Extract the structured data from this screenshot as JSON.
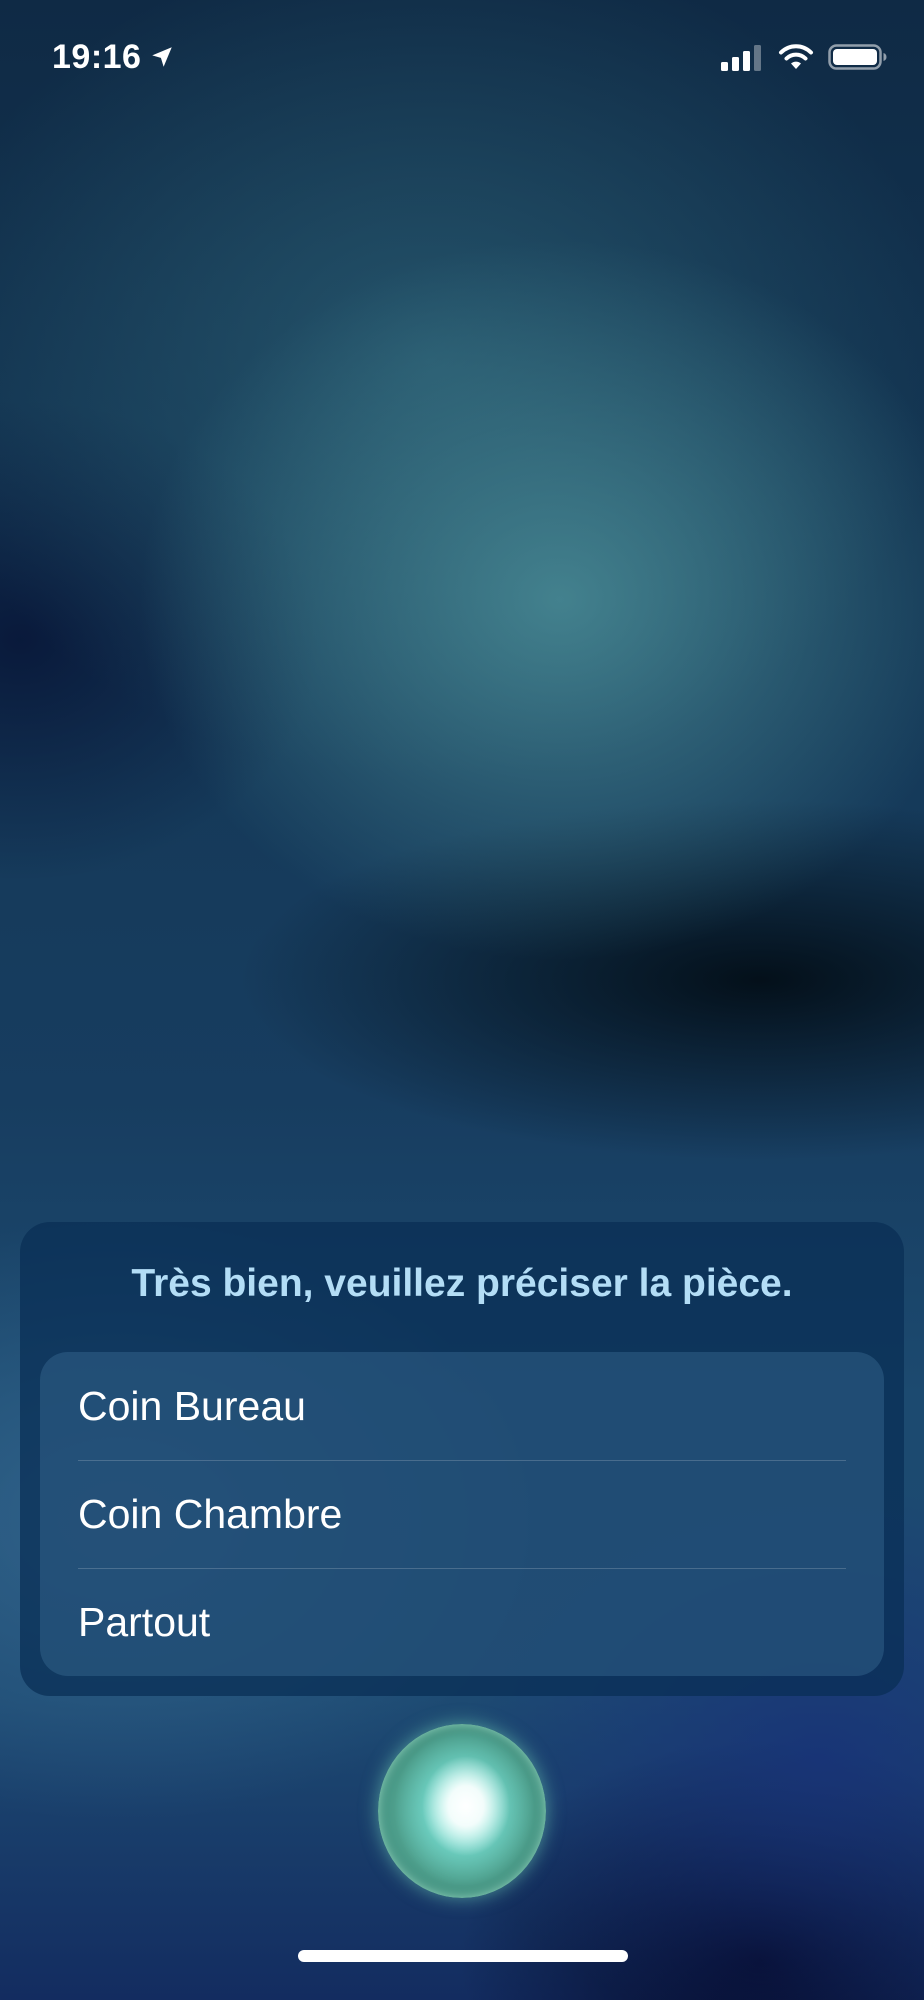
{
  "status_bar": {
    "time": "19:16",
    "icons": [
      "location-arrow-icon",
      "cellular-signal-icon",
      "wifi-icon",
      "battery-icon"
    ]
  },
  "siri": {
    "prompt": "Très bien, veuillez préciser la pièce.",
    "options": [
      {
        "label": "Coin Bureau"
      },
      {
        "label": "Coin Chambre"
      },
      {
        "label": "Partout"
      }
    ]
  },
  "colors": {
    "prompt_text": "#b3ddf6",
    "card_background": "#0b3156",
    "options_background": "#2b5478"
  }
}
